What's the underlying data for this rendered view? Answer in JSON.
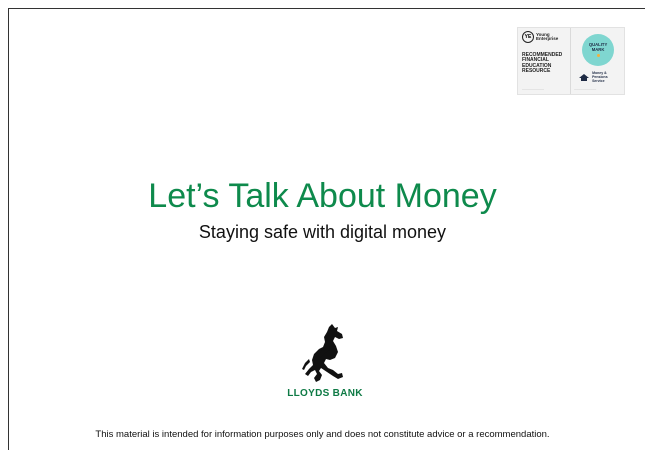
{
  "badge": {
    "ye_initials": "YE",
    "ye_name": "Young Enterprise",
    "recommended": "RECOMMENDED FINANCIAL EDUCATION RESOURCE",
    "quality_mark": "QUALITY MARK",
    "mhp_name": "Money & Pensions Service",
    "mark_color": "#7fd6d0"
  },
  "slide": {
    "title": "Let’s Talk About Money",
    "subtitle": "Staying safe with digital money",
    "title_color": "#0e8a4c"
  },
  "logo": {
    "bank_name": "LLOYDS BANK",
    "icon": "black-horse-icon"
  },
  "footer": {
    "disclaimer": "This material is intended for information purposes only and does not constitute advice or a recommendation."
  }
}
